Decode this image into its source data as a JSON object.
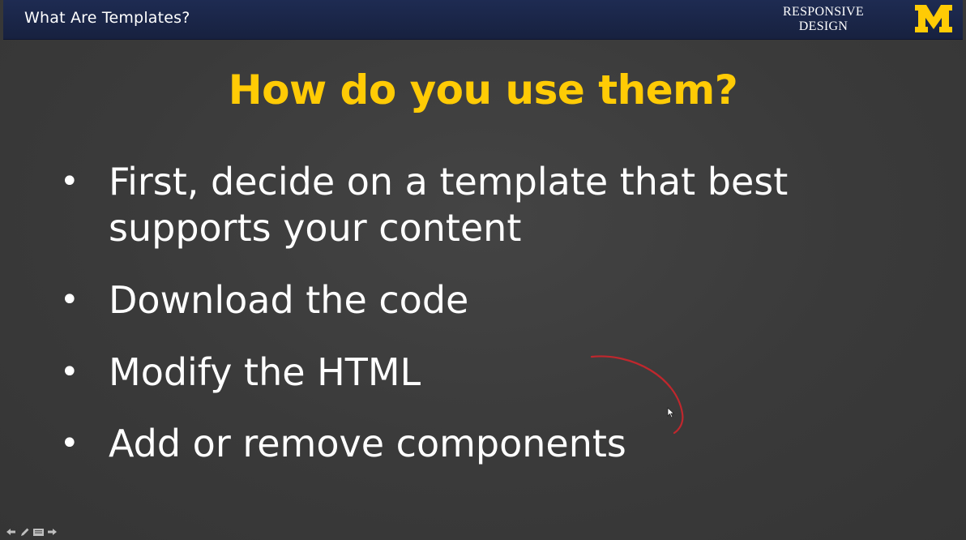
{
  "header": {
    "title": "What Are Templates?",
    "brand_line1": "RESPONSIVE",
    "brand_line2": "DESIGN",
    "logo_icon": "university-m-logo-icon",
    "logo_color": "#ffcb05",
    "bar_color": "#1e2b52"
  },
  "slide": {
    "heading": "How do you use them?",
    "heading_color": "#ffcb05",
    "bullet_symbol": "•",
    "bullets": [
      {
        "text": "First, decide on a template that best\nsupports your content"
      },
      {
        "text": "Download the code"
      },
      {
        "text": "Modify the HTML"
      },
      {
        "text": "Add or remove components"
      }
    ],
    "annotation_color": "#c0272d"
  },
  "nav_controls": {
    "icons": [
      "arrow-left-icon",
      "pen-icon",
      "slides-menu-icon",
      "arrow-right-icon"
    ]
  }
}
